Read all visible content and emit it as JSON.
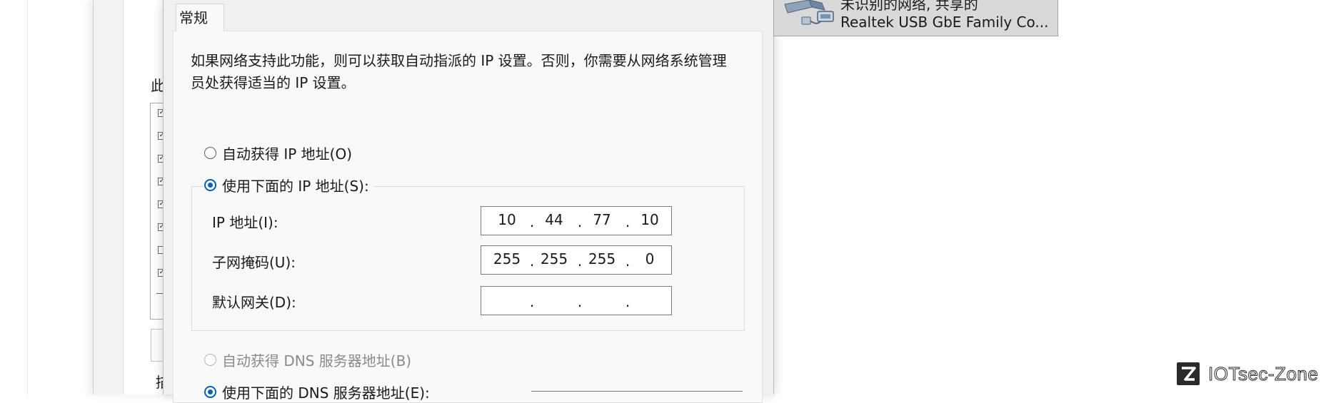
{
  "dialog": {
    "tab_label": "常规",
    "description": "如果网络支持此功能，则可以获取自动指派的 IP 设置。否则，你需要从网络系统管理员处获得适当的 IP 设置。",
    "radio_auto_ip": "自动获得 IP 地址(O)",
    "radio_manual_ip": "使用下面的 IP 地址(S):",
    "fields": {
      "ip_label": "IP 地址(I):",
      "ip_octets": [
        "10",
        "44",
        "77",
        "10"
      ],
      "mask_label": "子网掩码(U):",
      "mask_octets": [
        "255",
        "255",
        "255",
        "0"
      ],
      "gateway_label": "默认网关(D):",
      "gateway_octets": [
        "",
        "",
        "",
        ""
      ]
    },
    "radio_auto_dns": "自动获得 DNS 服务器地址(B)",
    "radio_manual_dns": "使用下面的 DNS 服务器地址(E):"
  },
  "parent": {
    "label_fragment": "此",
    "bottom_label_fragment": "描"
  },
  "adapter": {
    "status": "未识别的网络, 共享的",
    "name": "Realtek USB GbE Family Co..."
  },
  "watermark": {
    "text": "IOTsec-Zone"
  },
  "colors": {
    "accent": "#005fb8",
    "dialog_bg": "#f0f0f0",
    "panel_bg": "#f9f9f9"
  }
}
